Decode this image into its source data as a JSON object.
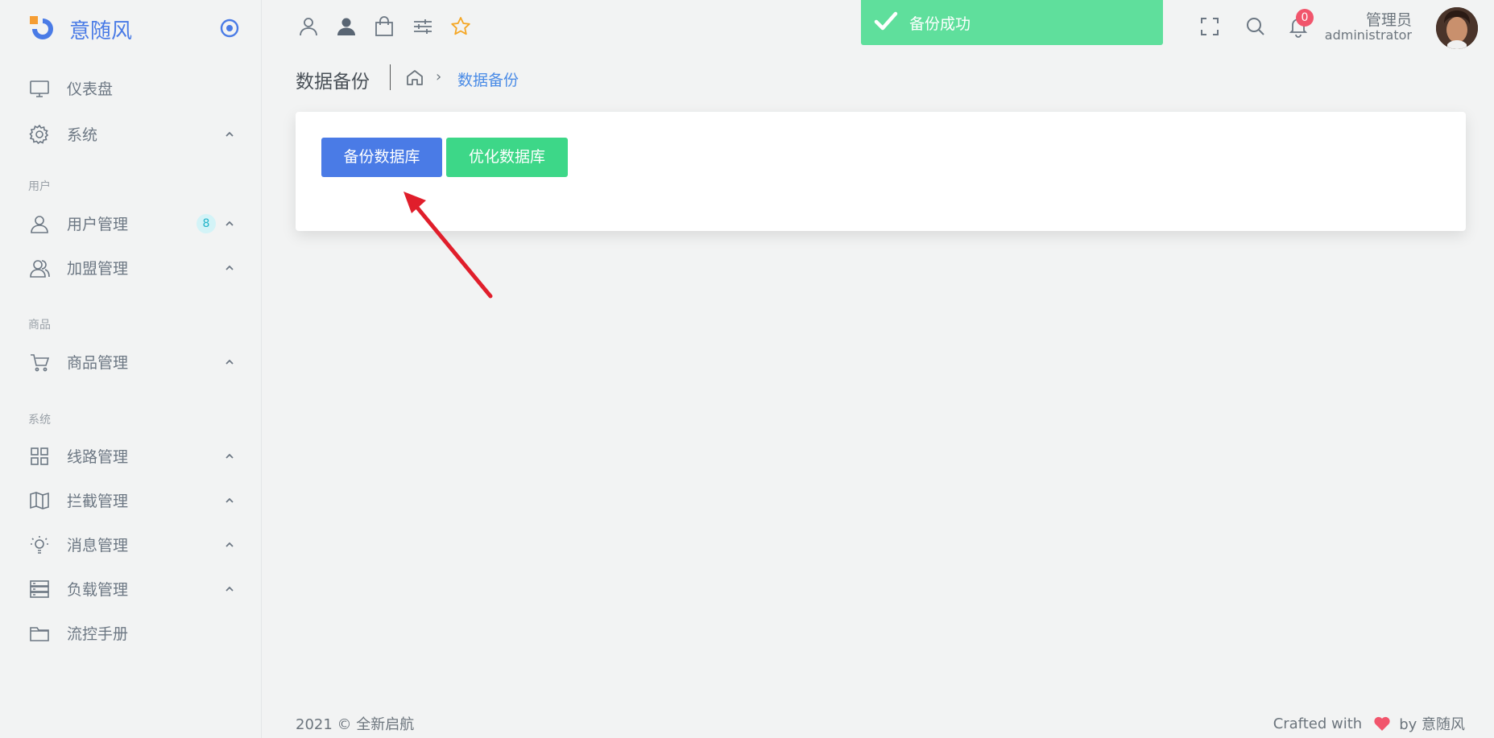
{
  "brand": {
    "name": "意随风"
  },
  "sidebar": {
    "items": [
      {
        "label": "仪表盘",
        "icon": "monitor-icon",
        "chevron": false
      },
      {
        "label": "系统",
        "icon": "gear-icon",
        "chevron": true
      },
      {
        "label": "用户管理",
        "icon": "user-icon",
        "chevron": true,
        "badge": "8"
      },
      {
        "label": "加盟管理",
        "icon": "users-icon",
        "chevron": true
      },
      {
        "label": "商品管理",
        "icon": "cart-icon",
        "chevron": true
      },
      {
        "label": "线路管理",
        "icon": "grid-icon",
        "chevron": true
      },
      {
        "label": "拦截管理",
        "icon": "map-icon",
        "chevron": true
      },
      {
        "label": "消息管理",
        "icon": "bulb-icon",
        "chevron": true
      },
      {
        "label": "负载管理",
        "icon": "server-icon",
        "chevron": true
      },
      {
        "label": "流控手册",
        "icon": "folder-icon",
        "chevron": false
      }
    ],
    "sections": [
      "用户",
      "商品",
      "系统"
    ]
  },
  "toast": {
    "message": "备份成功",
    "color": "#5fdf9c"
  },
  "header": {
    "notification_count": "0",
    "user_name": "管理员",
    "user_role": "administrator"
  },
  "page": {
    "title": "数据备份",
    "breadcrumb_current": "数据备份"
  },
  "actions": {
    "backup_label": "备份数据库",
    "optimize_label": "优化数据库"
  },
  "footer": {
    "copyright": "2021 © 全新启航",
    "crafted_prefix": "Crafted with",
    "crafted_suffix": "by 意随风"
  },
  "colors": {
    "primary": "#4a7be6",
    "success": "#3dd788",
    "danger": "#f1556c"
  }
}
